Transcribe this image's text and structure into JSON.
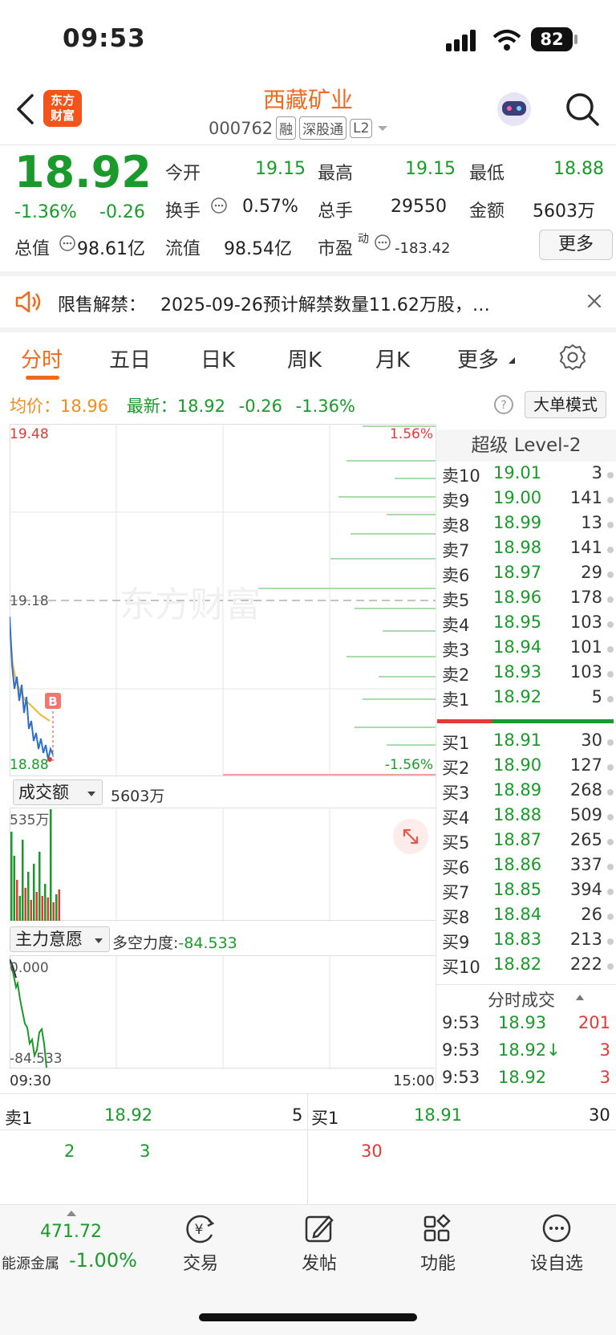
{
  "status": {
    "time": "09:53",
    "battery": "82"
  },
  "header": {
    "logo_line1": "东方",
    "logo_line2": "财富",
    "title": "西藏矿业",
    "code": "000762",
    "tags": [
      "融",
      "深股通",
      "L2"
    ]
  },
  "quote": {
    "price": "18.92",
    "change_pct": "-1.36%",
    "change": "-0.26",
    "open_label": "今开",
    "open": "19.15",
    "high_label": "最高",
    "high": "19.15",
    "low_label": "最低",
    "low": "18.88",
    "turnover_label": "换手",
    "turnover": "0.57%",
    "volume_label": "总手",
    "volume": "29550",
    "amount_label": "金额",
    "amount": "5603万",
    "mktcap_label": "总值",
    "mktcap": "98.61亿",
    "float_label": "流值",
    "float": "98.54亿",
    "pe_label": "市盈",
    "pe_sup": "动",
    "pe": "-183.42",
    "more": "更多"
  },
  "notice": {
    "label": "限售解禁：",
    "text": "2025-09-26预计解禁数量11.62万股，…"
  },
  "tabs": [
    "分时",
    "五日",
    "日K",
    "周K",
    "月K",
    "更多"
  ],
  "avg_line": {
    "avg_label": "均价：",
    "avg": "18.96",
    "latest_label": "最新：",
    "latest": "18.92",
    "chg": "-0.26",
    "chg_pct": "-1.36%",
    "mode_btn": "大单模式"
  },
  "intraday": {
    "y_top": "19.48",
    "y_mid": "19.18",
    "y_bottom": "18.88",
    "pct_top": "1.56%",
    "pct_bottom": "-1.56%",
    "watermark": "东方财富",
    "marker": "B",
    "vol_selector": "成交额",
    "vol_value": "5603万",
    "vol_max": "535万",
    "ind_selector": "主力意愿",
    "ind_label": "多空力度:",
    "ind_value": "-84.533",
    "ind_top": "0.000",
    "ind_bottom": "-84.533",
    "time_start": "09:30",
    "time_end": "15:00"
  },
  "orderbook": {
    "title": "超级 Level-2",
    "asks": [
      {
        "lv": "卖10",
        "price": "19.01",
        "vol": "3"
      },
      {
        "lv": "卖9",
        "price": "19.00",
        "vol": "141"
      },
      {
        "lv": "卖8",
        "price": "18.99",
        "vol": "13"
      },
      {
        "lv": "卖7",
        "price": "18.98",
        "vol": "141"
      },
      {
        "lv": "卖6",
        "price": "18.97",
        "vol": "29"
      },
      {
        "lv": "卖5",
        "price": "18.96",
        "vol": "178"
      },
      {
        "lv": "卖4",
        "price": "18.95",
        "vol": "103"
      },
      {
        "lv": "卖3",
        "price": "18.94",
        "vol": "101"
      },
      {
        "lv": "卖2",
        "price": "18.93",
        "vol": "103"
      },
      {
        "lv": "卖1",
        "price": "18.92",
        "vol": "5"
      }
    ],
    "bids": [
      {
        "lv": "买1",
        "price": "18.91",
        "vol": "30"
      },
      {
        "lv": "买2",
        "price": "18.90",
        "vol": "127"
      },
      {
        "lv": "买3",
        "price": "18.89",
        "vol": "268"
      },
      {
        "lv": "买4",
        "price": "18.88",
        "vol": "509"
      },
      {
        "lv": "买5",
        "price": "18.87",
        "vol": "265"
      },
      {
        "lv": "买6",
        "price": "18.86",
        "vol": "337"
      },
      {
        "lv": "买7",
        "price": "18.85",
        "vol": "394"
      },
      {
        "lv": "买8",
        "price": "18.84",
        "vol": "26"
      },
      {
        "lv": "买9",
        "price": "18.83",
        "vol": "213"
      },
      {
        "lv": "买10",
        "price": "18.82",
        "vol": "222"
      }
    ],
    "trades_title": "分时成交",
    "trades": [
      {
        "time": "9:53",
        "price": "18.93",
        "vol": "201"
      },
      {
        "time": "9:53",
        "price": "18.92↓",
        "vol": "3"
      },
      {
        "time": "9:53",
        "price": "18.92",
        "vol": "3"
      }
    ]
  },
  "queue": {
    "sell_label": "卖1",
    "sell_price": "18.92",
    "sell_vol": "5",
    "buy_label": "买1",
    "buy_price": "18.91",
    "buy_vol": "30",
    "sell_orders": [
      "2",
      "3"
    ],
    "buy_orders": [
      "30"
    ]
  },
  "bottom_nav": {
    "index_value": "471.72",
    "index_name": "能源金属",
    "index_chg": "-1.00%",
    "items": [
      "交易",
      "发帖",
      "功能",
      "设自选"
    ]
  },
  "colors": {
    "brand": "#f06a1d",
    "down": "#1a9a2a",
    "up": "#e53935",
    "avg": "#f5b82e",
    "price_line": "#2f6fc7"
  }
}
